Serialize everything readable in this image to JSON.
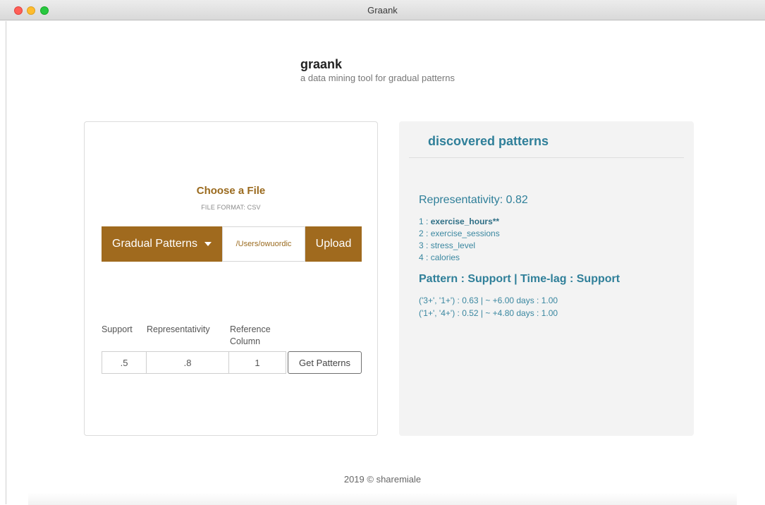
{
  "window": {
    "title": "Graank"
  },
  "header": {
    "title": "graank",
    "subtitle": "a data mining tool for gradual patterns"
  },
  "upload": {
    "heading": "Choose a File",
    "format_note": "FILE FORMAT: CSV",
    "mode_button": "Gradual Patterns",
    "file_path": "/Users/owuordic",
    "upload_button": "Upload"
  },
  "params": {
    "support_label": "Support",
    "representativity_label": "Representativity",
    "reference_label": "Reference Column",
    "support_value": ".5",
    "representativity_value": ".8",
    "reference_value": "1",
    "get_button": "Get Patterns"
  },
  "results": {
    "title": "discovered patterns",
    "representativity": "Representativity: 0.82",
    "items": [
      {
        "index": "1 : ",
        "name": "exercise_hours**"
      },
      {
        "index": "2 : ",
        "name": "exercise_sessions"
      },
      {
        "index": "3 : ",
        "name": "stress_level"
      },
      {
        "index": "4 : ",
        "name": "calories"
      }
    ],
    "pattern_header": "Pattern : Support | Time-lag : Support",
    "patterns": [
      "('3+', '1+') : 0.63 | ~ +6.00 days : 1.00",
      "('1+', '4+') : 0.52 | ~ +4.80 days : 1.00"
    ]
  },
  "footer": {
    "text": "2019 © sharemiale"
  },
  "colors": {
    "accent_brown": "#a06a1e",
    "accent_teal": "#2f7f99"
  }
}
